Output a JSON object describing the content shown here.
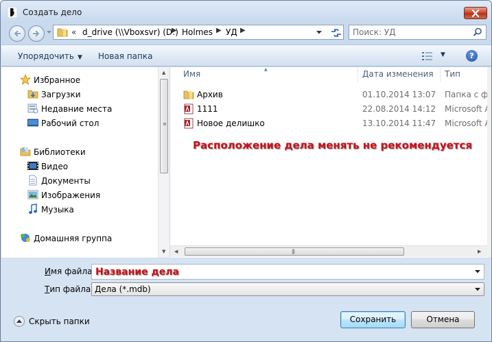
{
  "window": {
    "title": "Создать дело"
  },
  "address": {
    "chevron": "«",
    "crumbs": [
      "d_drive (\\\\Vboxsvr) (D:)",
      "Holmes",
      "УД"
    ]
  },
  "search": {
    "placeholder": "Поиск: УД"
  },
  "toolbar": {
    "organize_label": "Упорядочить",
    "new_folder_label": "Новая папка",
    "help_label": "?"
  },
  "nav": {
    "favorites": {
      "label": "Избранное",
      "items": [
        "Загрузки",
        "Недавние места",
        "Рабочий стол"
      ]
    },
    "libraries": {
      "label": "Библиотеки",
      "items": [
        "Видео",
        "Документы",
        "Изображения",
        "Музыка"
      ]
    },
    "homegroup": {
      "label": "Домашняя группа"
    }
  },
  "file_list": {
    "columns": {
      "name": "Имя",
      "date": "Дата изменения",
      "type": "Тип"
    },
    "rows": [
      {
        "name": "Архив",
        "date": "01.10.2014 13:07",
        "type": "Папка с ф",
        "icon": "folder-icon"
      },
      {
        "name": "1111",
        "date": "22.08.2014 14:12",
        "type": "Microsoft A",
        "icon": "access-db-icon"
      },
      {
        "name": "Новое делишко",
        "date": "13.10.2014 11:47",
        "type": "Microsoft A",
        "icon": "access-db-icon"
      }
    ]
  },
  "annotation": {
    "text": "Расположение дела менять не рекомендуется"
  },
  "form": {
    "filename_label_u": "И",
    "filename_label_rest": "мя файла:",
    "filename_value": "Название дела",
    "filetype_label_u": "Т",
    "filetype_label_rest": "ип файла:",
    "filetype_value": "Дела (*.mdb)",
    "hide_folders_label": "Скрыть папки",
    "save_label": "Сохранить",
    "cancel_label": "Отмена"
  },
  "colors": {
    "annotation_red": "#c9101a",
    "accent_blue": "#1e395b"
  }
}
